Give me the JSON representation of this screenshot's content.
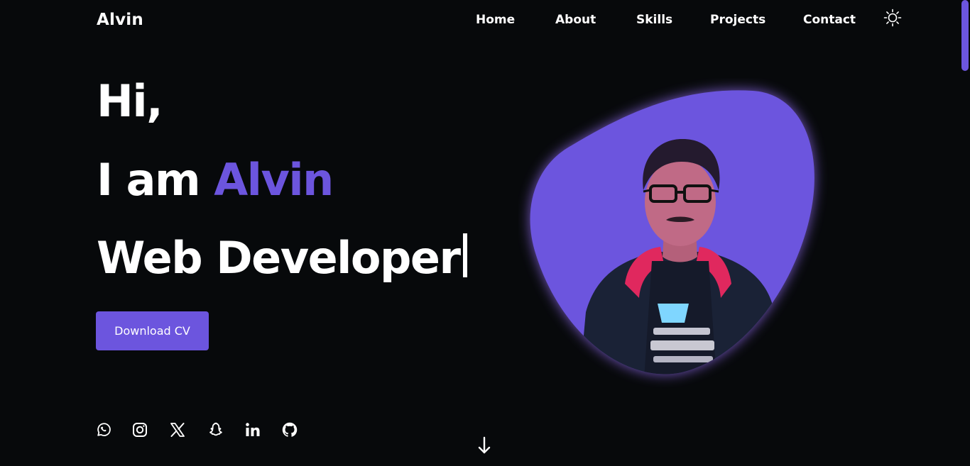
{
  "header": {
    "logo": "Alvin",
    "nav": [
      {
        "label": "Home"
      },
      {
        "label": "About"
      },
      {
        "label": "Skills"
      },
      {
        "label": "Projects"
      },
      {
        "label": "Contact"
      }
    ],
    "theme_toggle_icon": "sun-icon"
  },
  "hero": {
    "greeting": "Hi,",
    "intro_prefix": "I am",
    "name": "Alvin",
    "role": "Web Developer",
    "cv_button": "Download CV"
  },
  "portrait": {
    "icon": "profile-photo",
    "blob_color": "#6c55de"
  },
  "social": [
    {
      "icon": "whatsapp-icon"
    },
    {
      "icon": "instagram-icon"
    },
    {
      "icon": "x-icon"
    },
    {
      "icon": "snapchat-icon"
    },
    {
      "icon": "linkedin-icon"
    },
    {
      "icon": "github-icon"
    }
  ],
  "scroll_indicator": {
    "icon": "arrow-down-icon"
  },
  "colors": {
    "background": "#07090b",
    "accent": "#6c55de",
    "text": "#ffffff"
  }
}
